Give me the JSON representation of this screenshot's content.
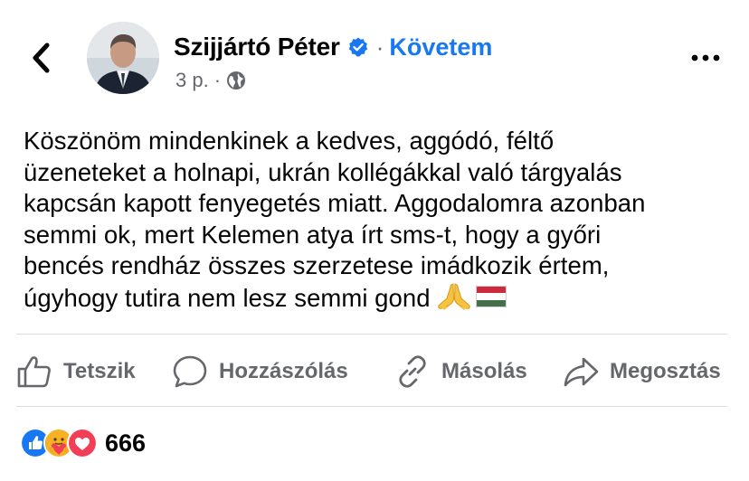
{
  "header": {
    "author_name": "Szijjártó Péter",
    "separator": "·",
    "follow_label": "Követem",
    "time": "3 p.",
    "meta_separator": "·",
    "back_icon": "chevron-left-icon",
    "more_icon": "more-horizontal-icon",
    "verified_icon": "verified-badge-icon",
    "audience_icon": "globe-icon"
  },
  "post": {
    "lines": [
      "Köszönöm mindenkinek a kedves, aggódó, féltő",
      "üzeneteket a holnapi, ukrán kollégákkal való tárgyalás",
      "kapcsán kapott fenyegetés miatt. Aggodalomra azonban",
      "semmi ok, mert Kelemen atya írt sms-t, hogy a győri",
      "bencés rendház összes szerzetese imádkozik értem,",
      "úgyhogy tutira nem lesz semmi gond"
    ],
    "emojis": [
      "folded-hands-emoji",
      "hungary-flag-emoji"
    ]
  },
  "actions": {
    "like_label": "Tetszik",
    "comment_label": "Hozzászólás",
    "copy_label": "Másolás",
    "share_label": "Megosztás"
  },
  "reactions": {
    "count": "666",
    "icons": [
      "like-reaction-icon",
      "care-reaction-icon",
      "love-reaction-icon"
    ]
  },
  "colors": {
    "accent": "#1877f2",
    "secondary_text": "#65676b",
    "primary_text": "#050505",
    "divider": "#dadde1",
    "love": "#f33e58",
    "care": "#f7b125"
  }
}
